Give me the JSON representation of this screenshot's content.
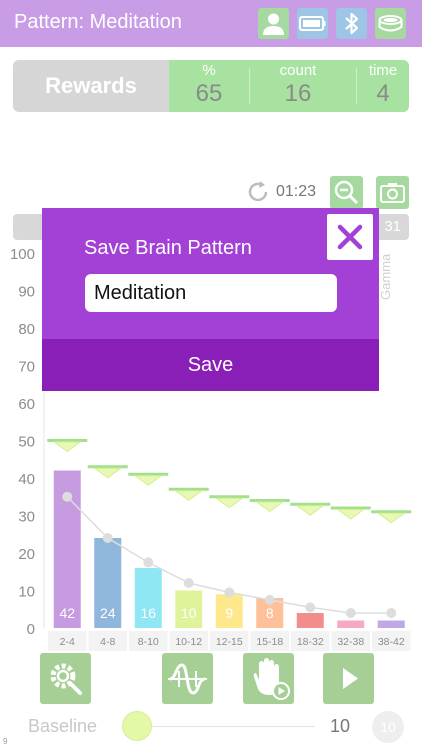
{
  "header": {
    "title": "Pattern: Meditation",
    "background_color": "#c89de6",
    "icons": [
      "user-icon",
      "battery-icon",
      "bluetooth-icon",
      "headband-icon"
    ]
  },
  "rewards": {
    "label": "Rewards",
    "percent_label": "%",
    "percent_value": "65",
    "count_label": "count",
    "count_value": "16",
    "time_label": "time",
    "time_value": "4",
    "accent_color": "#a8e2a0"
  },
  "timer": {
    "value": "01:23"
  },
  "strip": {
    "number": "31"
  },
  "gamma_label": "Gamma",
  "modal": {
    "title": "Save Brain Pattern",
    "input_value": "Meditation",
    "save_label": "Save",
    "color": "#a340d6",
    "save_color": "#8a1fb8"
  },
  "chart_data": {
    "type": "bar",
    "categories": [
      "2-4",
      "4-8",
      "8-10",
      "10-12",
      "12-15",
      "15-18",
      "18-32",
      "32-38",
      "38-42"
    ],
    "values": [
      42,
      24,
      16,
      10,
      9,
      8,
      4,
      2,
      2
    ],
    "value_labels": [
      "42",
      "24",
      "16",
      "10",
      "9",
      "8",
      "",
      "",
      ""
    ],
    "colors": [
      "#c79be0",
      "#8fb6db",
      "#8fe7f4",
      "#dff49a",
      "#fde98b",
      "#fdc098",
      "#f38d8d",
      "#f7a8c6",
      "#c0a8e6"
    ],
    "trend_line": [
      35,
      24,
      17.5,
      12,
      9.5,
      7.5,
      5.5,
      4,
      4
    ],
    "reward_thresholds": [
      50,
      43,
      41,
      37,
      35,
      34,
      33,
      32,
      31
    ],
    "y_ticks": [
      "0",
      "10",
      "20",
      "30",
      "40",
      "50",
      "60",
      "70",
      "80",
      "90",
      "100"
    ],
    "ylim": [
      0,
      100
    ],
    "grid": false
  },
  "bottom_buttons": [
    "settings-search-icon",
    "wave-icon",
    "hand-play-icon",
    "play-icon"
  ],
  "baseline": {
    "label": "Baseline",
    "value": "10",
    "badge": "10",
    "fraction": 0.0
  },
  "version": "9"
}
